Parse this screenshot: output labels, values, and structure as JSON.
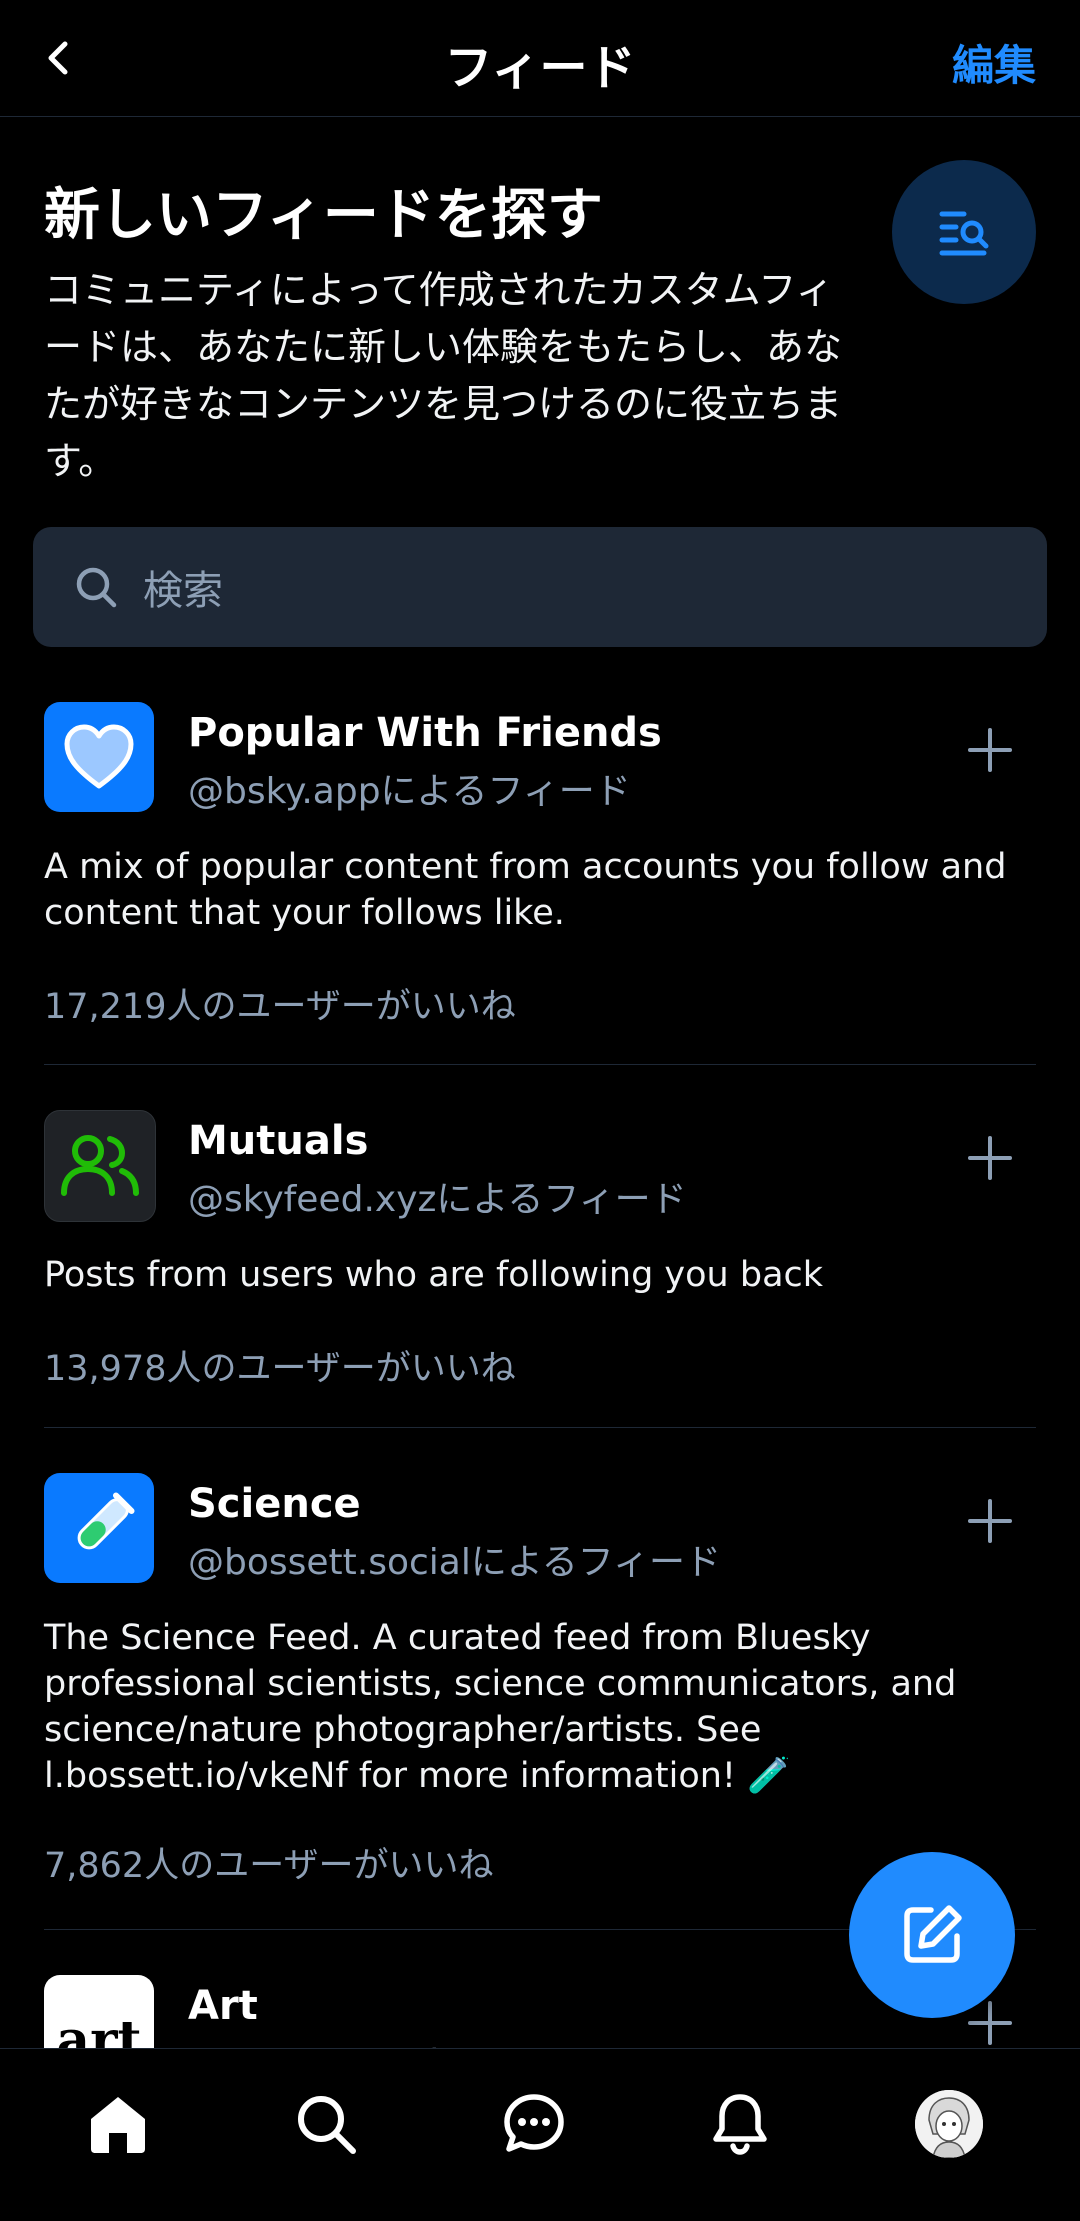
{
  "header": {
    "title": "フィード",
    "edit_label": "編集"
  },
  "intro": {
    "title": "新しいフィードを探す",
    "description": "コミュニティによって作成されたカスタムフィードは、あなたに新しい体験をもたらし、あなたが好きなコンテンツを見つけるのに役立ちます。"
  },
  "search": {
    "placeholder": "検索"
  },
  "feeds": [
    {
      "name": "Popular With Friends",
      "creator": "@bsky.appによるフィード",
      "description": "A mix of popular content from accounts you follow and content that your follows like.",
      "likes": "17,219人のユーザーがいいね",
      "avatar_color": "#0a7aff"
    },
    {
      "name": "Mutuals",
      "creator": "@skyfeed.xyzによるフィード",
      "description": "Posts from users who are following you back",
      "likes": "13,978人のユーザーがいいね",
      "avatar_color": "#1f2226"
    },
    {
      "name": "Science",
      "creator": "@bossett.socialによるフィード",
      "description": "The Science Feed. A curated feed from Bluesky professional scientists,  science communicators, and science/nature photographer/artists. See l.bossett.io/vkeNf for more information! 🧪",
      "likes": "7,862人のユーザーがいいね",
      "avatar_color": "#0a7aff"
    },
    {
      "name": "Art",
      "creator": "@bsky.appによるフィード",
      "avatar_text": "art",
      "avatar_color": "#ffffff"
    }
  ],
  "icons": {
    "back": "chevron-left-icon",
    "discover": "list-search-icon",
    "search": "search-icon",
    "add": "plus-icon",
    "compose": "compose-icon",
    "nav": [
      "home-icon",
      "search-icon",
      "chat-icon",
      "bell-icon",
      "profile-avatar"
    ]
  },
  "colors": {
    "accent": "#208bfe",
    "background": "#000000",
    "search_bg": "#1e2836",
    "muted_text": "#8d9fb5",
    "mutuals_green": "#20bc07"
  }
}
